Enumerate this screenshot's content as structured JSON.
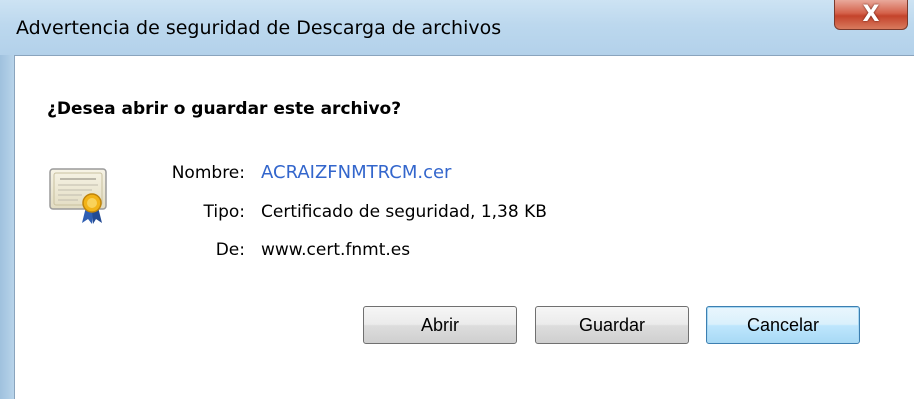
{
  "window": {
    "title": "Advertencia de seguridad de Descarga de archivos",
    "close_glyph": "X"
  },
  "dialog": {
    "question": "¿Desea abrir o guardar este archivo?",
    "icon": "certificate-icon",
    "fields": {
      "name_label": "Nombre:",
      "name_value": "ACRAIZFNMTRCM.cer",
      "type_label": "Tipo:",
      "type_value": "Certificado de seguridad, 1,38 KB",
      "from_label": "De:",
      "from_value": "www.cert.fnmt.es"
    },
    "buttons": {
      "open": "Abrir",
      "save": "Guardar",
      "cancel": "Cancelar"
    }
  },
  "colors": {
    "link": "#3366cc",
    "titlebar": "#bcd8ee",
    "close_button": "#c4432b"
  }
}
